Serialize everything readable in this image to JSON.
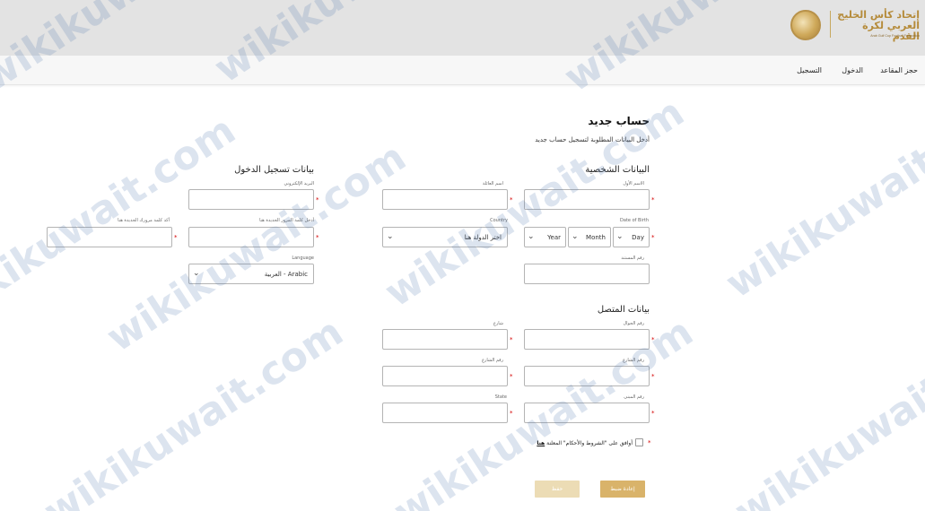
{
  "header": {
    "logo_title": "إتحاد كأس الخليج العربي لكرة القدم",
    "logo_subtitle": "Arab Gulf Cup Football Federation"
  },
  "nav": {
    "items": [
      {
        "label": "حجز المقاعد"
      },
      {
        "label": "الدخول"
      },
      {
        "label": "التسجيل"
      }
    ]
  },
  "page": {
    "title": "حساب جديد",
    "subtitle": "أدخل البيانات المطلوبة لتسجيل حساب جديد"
  },
  "personal": {
    "heading": "البيانات الشخصية",
    "first_name_label": "الاسم الأول",
    "last_name_label": "اسم العائلة",
    "dob_label": "Date of Birth",
    "day": "Day",
    "month": "Month",
    "year": "Year",
    "country_label": "Country",
    "country_value": "اختر الدولة هنا",
    "document_label": "رقم المستند"
  },
  "login": {
    "heading": "بيانات تسجيل الدخول",
    "email_label": "البريد الإلكتروني",
    "password_label": "أدخل كلمة المرور الجديدة هنا",
    "confirm_label": "أكد كلمة مرورك الجديدة هنا",
    "language_label": "Language",
    "language_value": "Arabic - العربية"
  },
  "contact": {
    "heading": "بيانات المتصل",
    "mobile_label": "رقم الجوال",
    "street_label": "شارع",
    "street_no_label": "رقم الشارع",
    "street_no2_label": "رقم الشارع",
    "building_label": "رقم المبنى",
    "state_label": "State"
  },
  "terms": {
    "text": "أوافق على \"الشروط والأحكام\" المعلنة",
    "link": "هنا"
  },
  "buttons": {
    "reset": "إعادة ضبط",
    "save": "حفظ"
  },
  "watermark": "wikikuwait.com",
  "colors": {
    "gold": "#d9b36a",
    "gold_light": "#ecdcb5",
    "required": "#d40000",
    "watermark": "#4e7ab0"
  }
}
